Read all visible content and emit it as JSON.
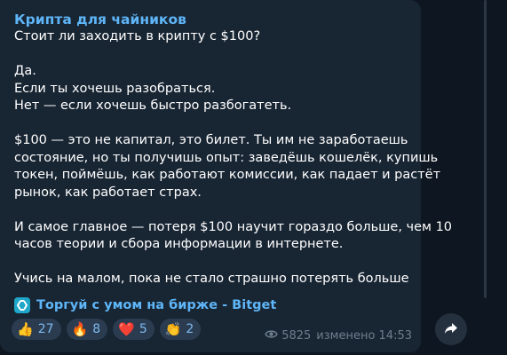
{
  "post": {
    "channel_name": "Крипта для чайников",
    "paragraphs": [
      [
        "Стоит ли заходить в крипту с $100?"
      ],
      [
        "Да.",
        "Если ты хочешь разобраться.",
        "Нет — если хочешь быстро разбогатеть."
      ],
      [
        "$100 — это не капитал, это билет. Ты им не заработаешь",
        "состояние, но ты получишь опыт: заведёшь кошелёк, купишь",
        "токен, поймёшь, как работают комиссии, как падает и растёт",
        "рынок, как работает страх."
      ],
      [
        "И самое главное — потеря $100 научит гораздо больше, чем 10",
        "часов теории и сбора информации в интернете."
      ],
      [
        "Учись на малом, пока не стало страшно потерять больше"
      ]
    ],
    "link": {
      "icon": "bitget-logo-icon",
      "label": "Торгуй с умом на бирже - Bitget"
    },
    "reactions": [
      {
        "emoji": "👍",
        "name": "thumbs-up-icon",
        "count": "27"
      },
      {
        "emoji": "🔥",
        "name": "fire-icon",
        "count": "8"
      },
      {
        "emoji": "❤️",
        "name": "heart-icon",
        "count": "5"
      },
      {
        "emoji": "👏",
        "name": "clapping-hands-icon",
        "count": "2"
      }
    ],
    "views": "5825",
    "edited_label": "изменено 14:53"
  },
  "colors": {
    "background": "#0e1621",
    "bubble": "#182533",
    "accent": "#5eb5f7",
    "reaction_bg": "#2b3c50"
  },
  "icons": {
    "views": "eye-icon",
    "share": "share-arrow-icon"
  }
}
